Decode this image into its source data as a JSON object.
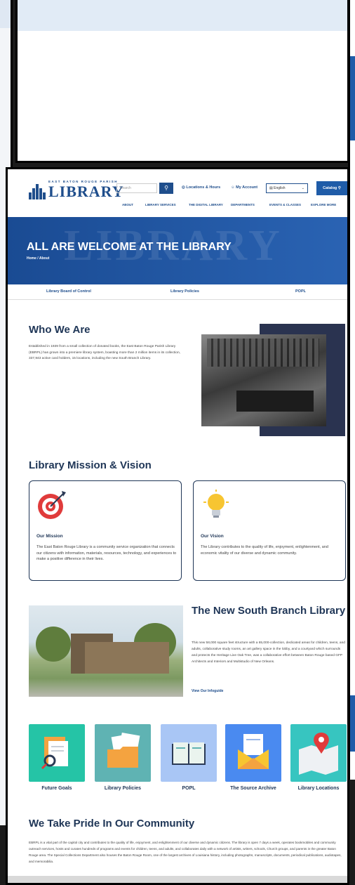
{
  "header": {
    "logo_small": "EAST BATON ROUGE PARISH",
    "logo_big": "LIBRARY",
    "search_placeholder": "Search",
    "locations_hours": "Locations & Hours",
    "my_account": "My Account",
    "language": "English",
    "catalog": "Catalog",
    "nav": [
      "ABOUT",
      "LIBRARY SERVICES",
      "THE DIGITAL LIBRARY",
      "DEPARTMENTS",
      "EVENTS & CLASSES",
      "EXPLORE MORE"
    ]
  },
  "hero": {
    "ghost": "LIBRARY",
    "title": "ALL ARE WELCOME AT THE LIBRARY",
    "breadcrumb": "Home / About"
  },
  "subnav": [
    "Library Board of Control",
    "Library Policies",
    "POPL"
  ],
  "who": {
    "title": "Who We Are",
    "text": "Established in 1939 from a small collection of donated books, the East Baton Rouge Parish Library (EBRPL) has grown into a premiere library system, boasting more than 2 million items in its collection, 337,943 active card holders, 15 locations, including the new South Branch Library."
  },
  "mission": {
    "title": "Library Mission & Vision",
    "cards": [
      {
        "title": "Our Mission",
        "text": "The East Baton Rouge Library is a community service organization that connects our citizens with information, materials, resources, technology, and experiences to make a positive difference in their lives."
      },
      {
        "title": "Our Vision",
        "text": "The Library contributes to the quality of life, enjoyment, enlightenment, and economic vitality of our diverse and dynamic community."
      }
    ]
  },
  "south_branch": {
    "title": "The New South Branch Library",
    "text": "This new 58,000 square feet structure with a 65,000-collection, dedicated areas for children, teens, and adults, collaborative study rooms, an art gallery space in the lobby, and a courtyard which surrounds and protects the Heritage Live Oak Tree, was a collaborative effort between Baton Rouge based GFP Architects and Interiors and Multistudio of New Orleans.",
    "link": "View Our Infoguide"
  },
  "tiles": [
    {
      "label": "Future Goals",
      "color": "#25c4a6"
    },
    {
      "label": "Library Policies",
      "color": "#5fb3b3"
    },
    {
      "label": "POPL",
      "color": "#a9c6f5"
    },
    {
      "label": "The Source Archive",
      "color": "#4a8af0"
    },
    {
      "label": "Library Locations",
      "color": "#37c5c0"
    }
  ],
  "pride": {
    "title": "We Take Pride In Our Community",
    "text": "EBRPL is a vital part of the capitol city and contributes to the quality of life, enjoyment, and enlightenment of our diverse and dynamic citizens. The library is open 7 days a week, operates bookmobiles and community outreach services, hosts and curates hundreds of programs and events for children, teens, and adults, and collaborates daily with a network of artists, writers, schools, Church groups, and parents in the greater Baton Rouge area. The Special Collections Department also houses the Baton Rouge Room, one of the largest archives of Louisiana history, including photographs, manuscripts, documents, periodical publications, audiotapes, and memorabilia."
  }
}
